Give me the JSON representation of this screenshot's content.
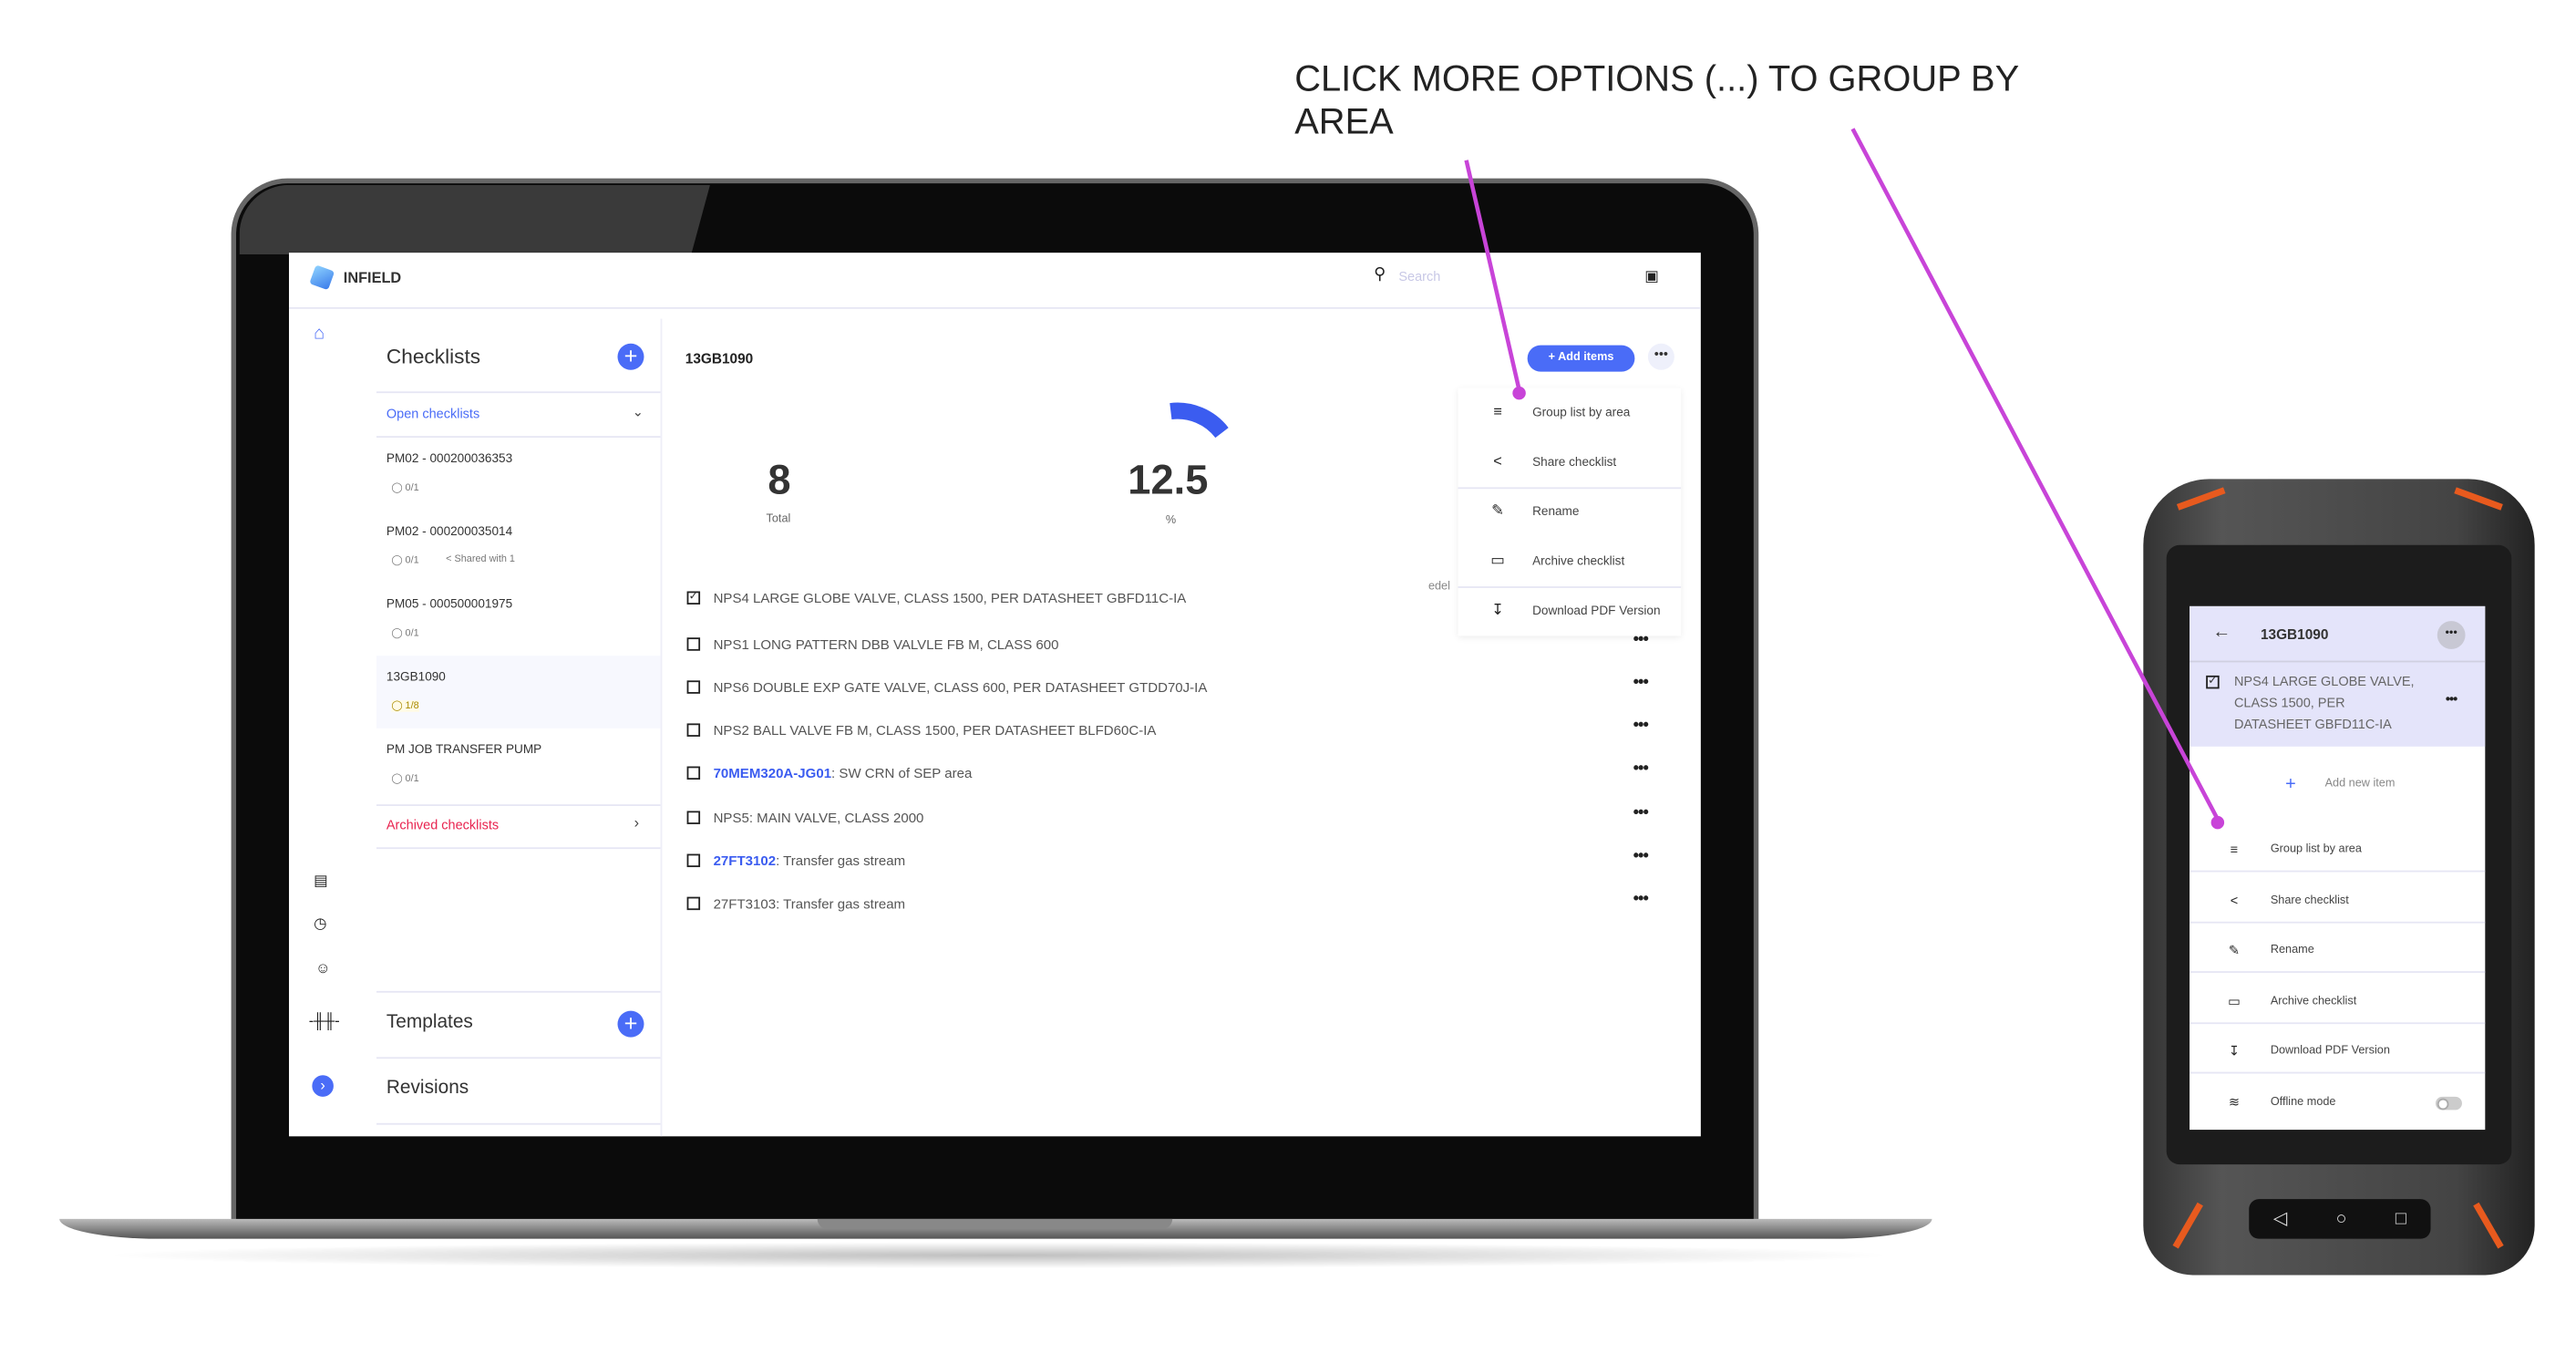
{
  "annotation": "CLICK MORE OPTIONS (...) TO GROUP BY AREA",
  "colors": {
    "accent": "#4a6cf7",
    "archived": "#e8234f",
    "annotation_line": "#c844d8"
  },
  "app": {
    "name": "INFIELD",
    "search_placeholder": "Search"
  },
  "rail": {
    "icons": [
      "home-icon",
      "message-icon",
      "alert-icon",
      "person-icon",
      "signal-icon",
      "expand-icon"
    ]
  },
  "sidebar": {
    "checklists_title": "Checklists",
    "open_label": "Open checklists",
    "items": [
      {
        "name": "PM02 - 000200036353",
        "progress": "0/1"
      },
      {
        "name": "PM02 - 000200035014",
        "progress": "0/1",
        "shared": "Shared with 1"
      },
      {
        "name": "PM05 - 000500001975",
        "progress": "0/1"
      },
      {
        "name": "13GB1090",
        "progress": "1/8"
      },
      {
        "name": "PM JOB TRANSFER PUMP",
        "progress": "0/1"
      }
    ],
    "archived_label": "Archived checklists",
    "templates_title": "Templates",
    "revisions_title": "Revisions"
  },
  "main": {
    "title": "13GB1090",
    "add_items": "Add items",
    "total_value": "8",
    "total_label": "Total",
    "percent_value": "12.5",
    "percent_label": "%",
    "hidden_text": "edel",
    "items": [
      {
        "checked": true,
        "text": "NPS4 LARGE GLOBE VALVE, CLASS 1500, PER DATASHEET GBFD11C-IA"
      },
      {
        "checked": false,
        "text": "NPS1 LONG PATTERN DBB VALVLE FB M, CLASS 600"
      },
      {
        "checked": false,
        "text": "NPS6 DOUBLE EXP GATE VALVE, CLASS 600, PER DATASHEET GTDD70J-IA"
      },
      {
        "checked": false,
        "text": "NPS2 BALL VALVE FB M, CLASS 1500, PER DATASHEET BLFD60C-IA"
      },
      {
        "checked": false,
        "tag": "70MEM320A-JG01",
        "text": ": SW CRN of SEP area"
      },
      {
        "checked": false,
        "text": "NPS5: MAIN VALVE, CLASS 2000"
      },
      {
        "checked": false,
        "tag": "27FT3102",
        "text": ": Transfer gas stream"
      },
      {
        "checked": false,
        "text": "27FT3103: Transfer gas stream"
      }
    ]
  },
  "menu": [
    {
      "icon": "group-list-icon",
      "label": "Group list by area"
    },
    {
      "icon": "share-icon",
      "label": "Share checklist"
    },
    {
      "icon": "pencil-icon",
      "label": "Rename"
    },
    {
      "icon": "folder-icon",
      "label": "Archive checklist"
    },
    {
      "icon": "download-pdf-icon",
      "label": "Download PDF Version"
    }
  ],
  "phone": {
    "title": "13GB1090",
    "item_lines": [
      "NPS4 LARGE GLOBE VALVE,",
      "CLASS 1500, PER",
      "DATASHEET GBFD11C-IA"
    ],
    "add_new": "Add new item",
    "offline_label": "Offline mode",
    "offline_on": false
  }
}
